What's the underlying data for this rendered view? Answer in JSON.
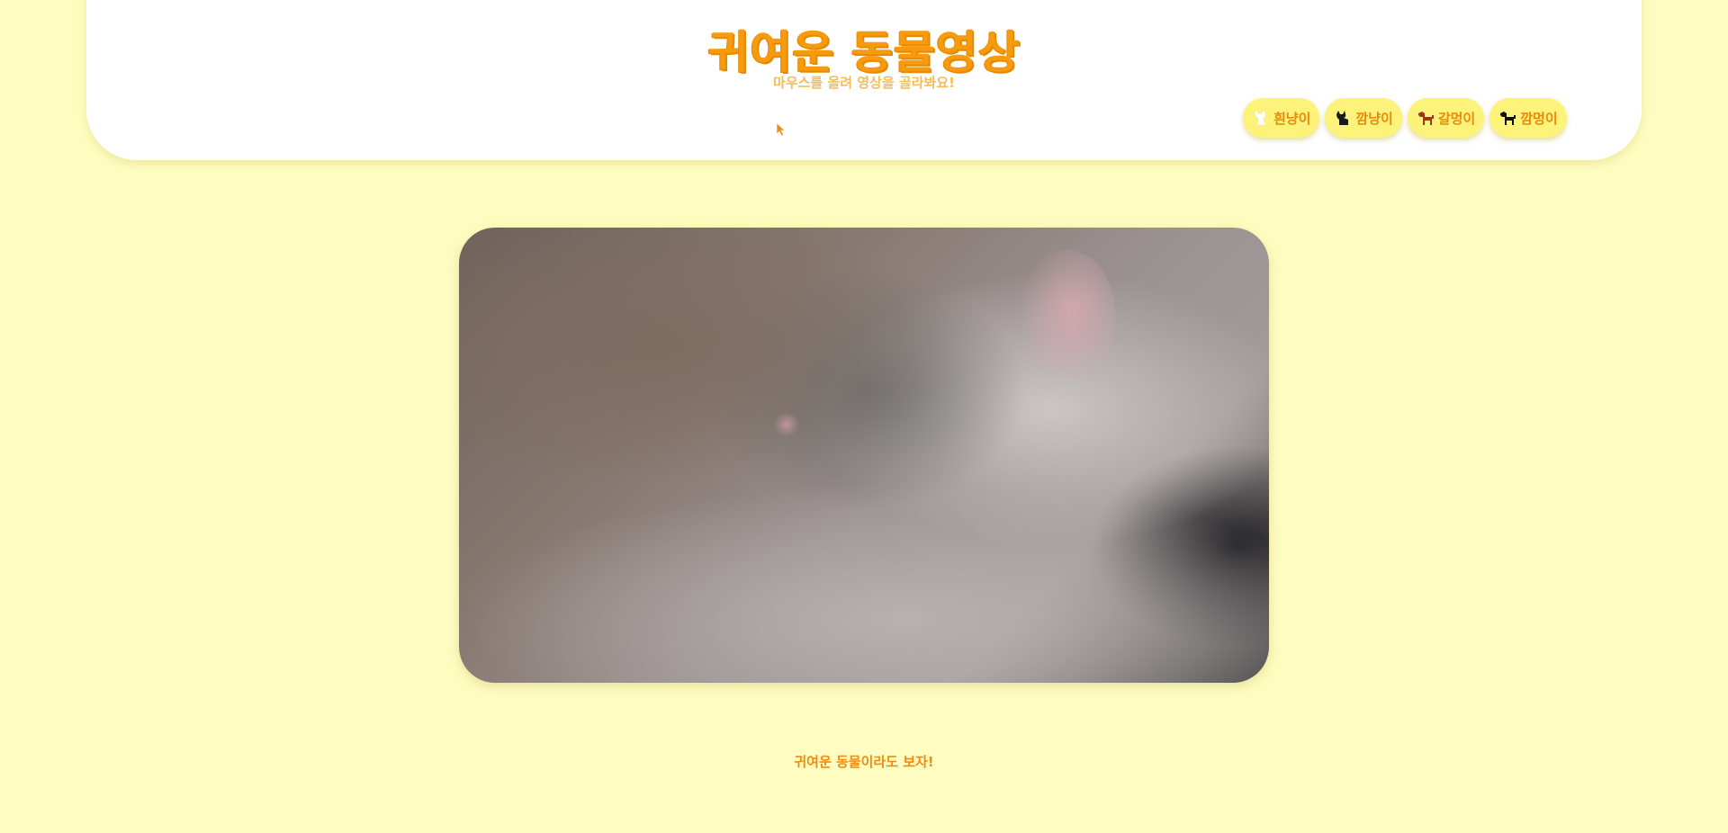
{
  "header": {
    "title": "귀여운 동물영상",
    "subtitle": "마우스를 올려 영상을 골라봐요!"
  },
  "nav": {
    "items": [
      {
        "label": "흰냥이",
        "icon": "white-cat-icon"
      },
      {
        "label": "깜냥이",
        "icon": "black-cat-icon"
      },
      {
        "label": "갈멍이",
        "icon": "brown-dog-icon"
      },
      {
        "label": "깜멍이",
        "icon": "black-dog-icon"
      }
    ]
  },
  "video": {
    "subject": "sleeping white cat"
  },
  "footer": {
    "text": "귀여운 동물이라도 보자!"
  },
  "colors": {
    "background": "#fefcc0",
    "accent": "#f79a0e",
    "button": "#fdf27a"
  }
}
